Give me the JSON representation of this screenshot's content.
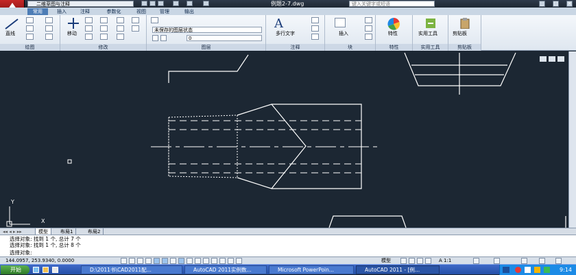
{
  "titlebar": {
    "workspace": "二维草图与注释",
    "document_title": "例题2-7.dwg",
    "search_placeholder": "键入关键字或短语"
  },
  "ribbon_tabs": [
    "常用",
    "插入",
    "注释",
    "参数化",
    "视图",
    "管理",
    "输出"
  ],
  "active_tab": "常用",
  "ribbon": {
    "panels": [
      "绘图",
      "修改",
      "图层",
      "注释",
      "块",
      "特性",
      "实用工具",
      "剪贴板"
    ],
    "draw_line_label": "直线",
    "modify_move_label": "移动",
    "layer_state": "未保存的图层状态",
    "layer_current": "0",
    "annotation_text_label": "多行文字",
    "block_insert_label": "插入",
    "properties_label": "特性",
    "utilities_label": "实用工具",
    "clipboard_label": "剪贴板"
  },
  "layout_tabs": [
    "模型",
    "布局1",
    "布局2"
  ],
  "command": {
    "history": [
      "选择对象: 找到 1 个, 总计 7 个",
      "选择对象: 找到 1 个, 总计 8 个"
    ],
    "prompt": "选择对象:"
  },
  "status": {
    "coordinates": "144.0957, 253.9340, 0.0000",
    "model_label": "模型",
    "scale": "A 1:1"
  },
  "taskbar": {
    "start_label": "开始",
    "tasks": [
      "D:\\2011书\\CAD2011配...",
      "AutoCAD 2011实例数...",
      "Microsoft PowerPoin...",
      "AutoCAD 2011 - [例..."
    ],
    "clock": "9:14"
  },
  "ucs": {
    "y_label": "Y",
    "x_label": "X"
  }
}
